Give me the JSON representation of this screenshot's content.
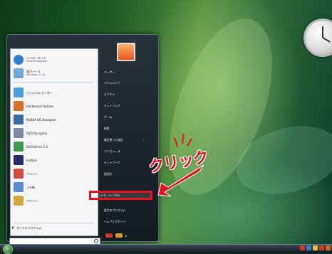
{
  "annotation": {
    "text": "クリック",
    "color": "#e8111f"
  },
  "start_menu": {
    "pinned": [
      {
        "label": "インターネット",
        "sub": "Internet Explorer",
        "icon": "ie-icon",
        "color": "#2f7bd6"
      },
      {
        "label": "電子メール",
        "sub": "Windows メール",
        "icon": "mail-icon",
        "color": "#6fa8d8"
      }
    ],
    "recent": [
      {
        "label": "ウェルカム センター",
        "icon": "welcome-center-icon",
        "color": "#4d9fe0"
      },
      {
        "label": "Dashboard Options",
        "icon": "dashboard-icon",
        "color": "#d9702a"
      },
      {
        "label": "NVIDIA HD Navigator",
        "icon": "nvidia-icon",
        "color": "#3a6aa8"
      },
      {
        "label": "DVD Navigator",
        "icon": "dvd-icon",
        "color": "#7a8aa0"
      },
      {
        "label": "DVD-Writer 2.2",
        "icon": "dvd-writer-icon",
        "color": "#3c9a4c"
      },
      {
        "label": "InstEnd",
        "icon": "app-icon",
        "color": "#2a2a6a"
      },
      {
        "label": "ペイント",
        "icon": "paint-icon",
        "color": "#d24a3a"
      },
      {
        "label": "メモ帳",
        "icon": "notepad-icon",
        "color": "#5a8ad0"
      },
      {
        "label": "ペイント",
        "icon": "paint2-icon",
        "color": "#d8a63a"
      }
    ],
    "all_programs": "すべてのプログラム",
    "search_placeholder": "検索の開始",
    "right_items": [
      "ドキュメント",
      "ピクチャ",
      "ミュージック",
      "ゲーム",
      "検索",
      "最近使った項目",
      "コンピュータ",
      "ネットワーク",
      "接続先",
      "コントロール パネル",
      "既定のプログラム",
      "ヘルプとサポート"
    ],
    "right_user": "ユーザー"
  },
  "taskbar": {
    "time": ""
  }
}
